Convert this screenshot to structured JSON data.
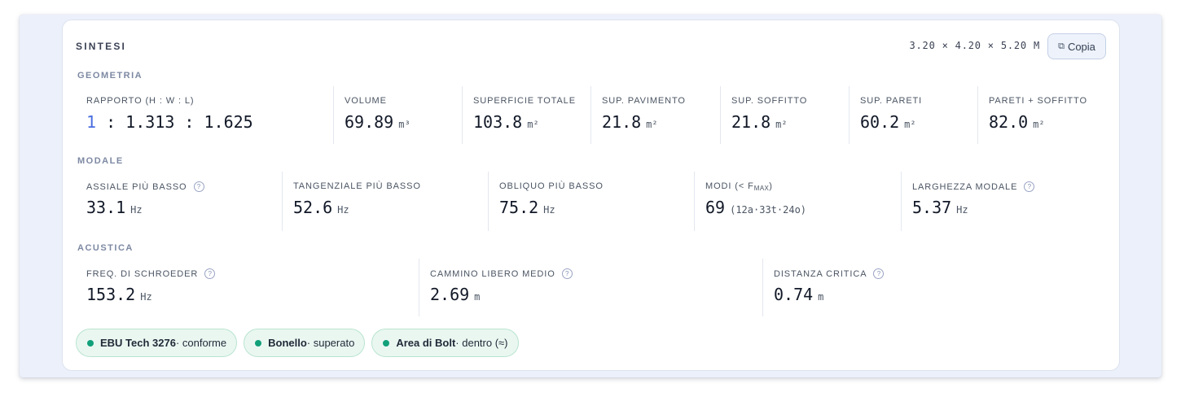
{
  "header": {
    "title": "SINTESI",
    "dimensions": "3.20 × 4.20 × 5.20 M",
    "copy_label": "Copia",
    "copy_icon": "copy-icon"
  },
  "geometria": {
    "label": "GEOMETRIA",
    "ratio": {
      "label": "RAPPORTO (H : W : L)",
      "first": "1",
      "rest": " : 1.313 : 1.625"
    },
    "cells": [
      {
        "label": "VOLUME",
        "value": "69.89",
        "unit": "m³"
      },
      {
        "label": "SUPERFICIE TOTALE",
        "value": "103.8",
        "unit": "m²"
      },
      {
        "label": "SUP. PAVIMENTO",
        "value": "21.8",
        "unit": "m²"
      },
      {
        "label": "SUP. SOFFITTO",
        "value": "21.8",
        "unit": "m²"
      },
      {
        "label": "SUP. PARETI",
        "value": "60.2",
        "unit": "m²"
      },
      {
        "label": "PARETI + SOFFITTO",
        "value": "82.0",
        "unit": "m²"
      }
    ]
  },
  "modale": {
    "label": "MODALE",
    "cells": [
      {
        "label": "ASSIALE PIÙ BASSO",
        "value": "33.1",
        "unit": "Hz",
        "help": "?"
      },
      {
        "label": "TANGENZIALE PIÙ BASSO",
        "value": "52.6",
        "unit": "Hz"
      },
      {
        "label": "OBLIQUO PIÙ BASSO",
        "value": "75.2",
        "unit": "Hz"
      },
      {
        "label_prefix": "MODI (< F",
        "label_sub": "MAX",
        "label_suffix": ")",
        "value": "69",
        "unit": "(12a·33t·24o)"
      },
      {
        "label": "LARGHEZZA MODALE",
        "value": "5.37",
        "unit": "Hz",
        "help": "?"
      }
    ]
  },
  "acustica": {
    "label": "ACUSTICA",
    "cells": [
      {
        "label": "FREQ. DI SCHROEDER",
        "value": "153.2",
        "unit": "Hz",
        "help": "?"
      },
      {
        "label": "CAMMINO LIBERO MEDIO",
        "value": "2.69",
        "unit": "m",
        "help": "?"
      },
      {
        "label": "DISTANZA CRITICA",
        "value": "0.74",
        "unit": "m",
        "help": "?"
      }
    ]
  },
  "badges": [
    {
      "name": "EBU Tech 3276",
      "status": " · conforme"
    },
    {
      "name": "Bonello",
      "status": " · superato"
    },
    {
      "name": "Area di Bolt",
      "status": " · dentro (≈)"
    }
  ],
  "colors": {
    "accent": "#4a6ee0",
    "status_dot": "#11a07a",
    "badge_bg": "#eaf7f1",
    "backdrop": "#ebf0fa"
  }
}
